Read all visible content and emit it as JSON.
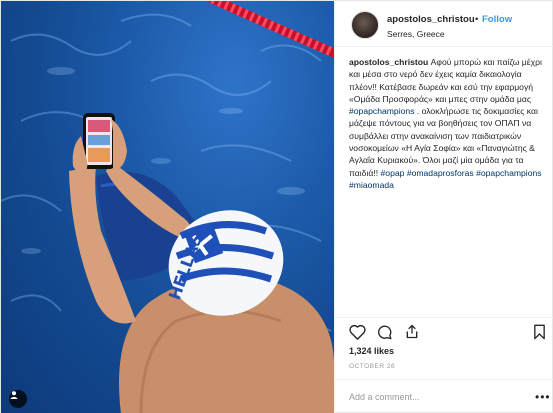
{
  "post": {
    "author": {
      "username": "apostolos_christou",
      "location": "Serres, Greece",
      "follow_separator": "•",
      "follow_label": "Follow"
    },
    "caption": {
      "username": "apostolos_christou",
      "segments": [
        {
          "text": "Αφού μπορώ και παίζω μέχρι και μέσα στο νερό δεν έχεις καμία δικαιολογία πλέον!! Κατέβασε δωρεάν και εσύ την εφαρμογή «Ομάδα Προσφοράς» και μπες στην ομάδα μας ",
          "tag": false
        },
        {
          "text": "#opapchampions",
          "tag": true
        },
        {
          "text": " . ολοκλήρωσε τις δοκιμασίες και μάζεψε πόντους για να βοηθήσεις τον ΟΠΑΠ να συμβάλλει στην ανακαίνιση των παιδιατρικών νοσοκομείων «Η Αγία Σοφία» και «Παναγιώτης & Αγλαΐα Κυριακού». Όλοι μαζί μία ομάδα για τα παιδιά!! ",
          "tag": false
        },
        {
          "text": "#opap",
          "tag": true
        },
        {
          "text": " ",
          "tag": false
        },
        {
          "text": "#omadaprosforas",
          "tag": true
        },
        {
          "text": " ",
          "tag": false
        },
        {
          "text": "#opapchampions",
          "tag": true
        },
        {
          "text": " ",
          "tag": false
        },
        {
          "text": "#miaomada",
          "tag": true
        }
      ]
    },
    "actions": {
      "like_icon": "heart-icon",
      "comment_icon": "comment-icon",
      "share_icon": "share-icon",
      "save_icon": "bookmark-icon"
    },
    "likes_label": "1,324 likes",
    "date_label": "OCTOBER 26",
    "comment": {
      "placeholder": "Add a comment...",
      "value": "",
      "more_label": "•••"
    },
    "photo": {
      "tagged_icon": "person-tag-icon"
    }
  }
}
